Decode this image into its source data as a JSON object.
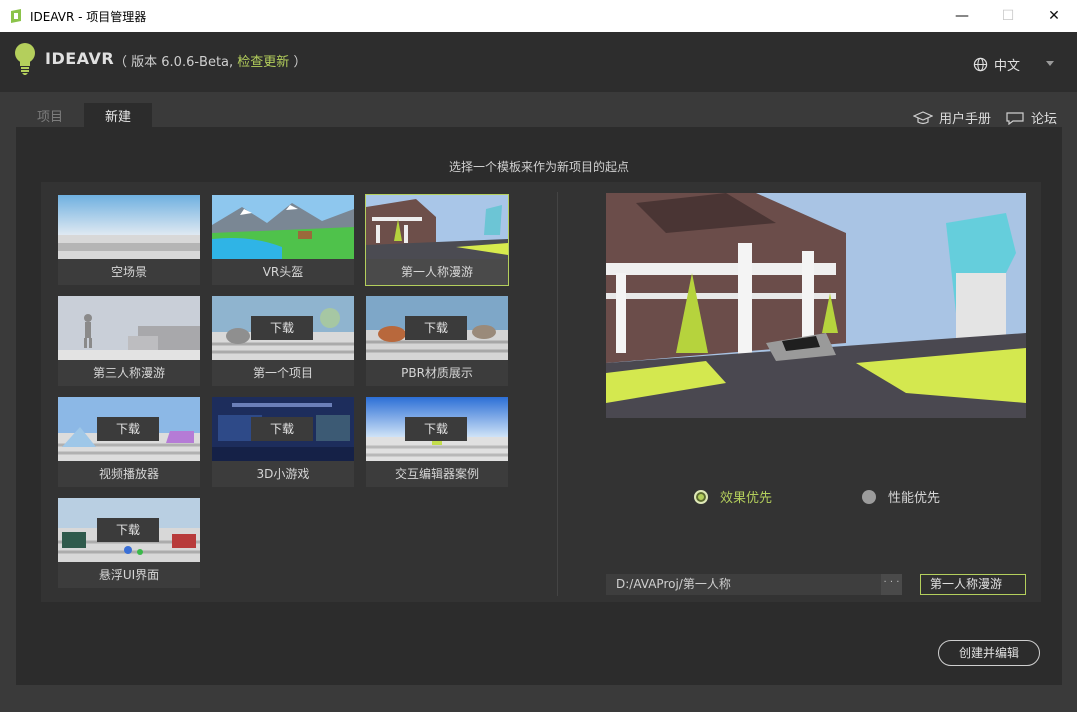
{
  "window": {
    "title": "IDEAVR - 项目管理器",
    "minimize": "—",
    "maximize": "☐",
    "close": "✕"
  },
  "header": {
    "brand": "IDEAVR",
    "version_open": "（ 版本 6.0.6-Beta,",
    "check_update": "检查更新",
    "version_close": "）",
    "language": "中文"
  },
  "tabs": [
    {
      "label": "项目"
    },
    {
      "label": "新建"
    }
  ],
  "top_links": {
    "manual": "用户手册",
    "forum": "论坛"
  },
  "panel": {
    "hint": "选择一个模板来作为新项目的起点",
    "templates": [
      {
        "label": "空场景",
        "download": ""
      },
      {
        "label": "VR头盔",
        "download": ""
      },
      {
        "label": "第一人称漫游",
        "download": ""
      },
      {
        "label": "第三人称漫游",
        "download": ""
      },
      {
        "label": "第一个项目",
        "download": "下载"
      },
      {
        "label": "PBR材质展示",
        "download": "下载"
      },
      {
        "label": "视频播放器",
        "download": "下载"
      },
      {
        "label": "3D小游戏",
        "download": "下载"
      },
      {
        "label": "交互编辑器案例",
        "download": "下载"
      },
      {
        "label": "悬浮UI界面",
        "download": "下载"
      }
    ],
    "quality": {
      "option_a": "效果优先",
      "option_b": "性能优先",
      "selected": "效果优先"
    },
    "path": "D:/AVAProj/第一人称",
    "browse": "· · ·",
    "name": "第一人称漫游",
    "create_button": "创建并编辑"
  },
  "colors": {
    "accent": "#b4cf5c",
    "background": "#3a3a3a",
    "panel": "#2c2c2c"
  }
}
